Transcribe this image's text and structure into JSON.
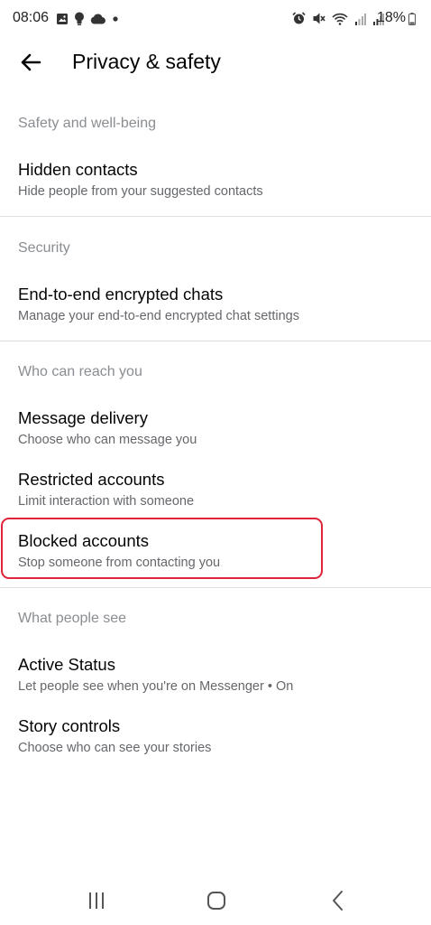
{
  "status_bar": {
    "time": "08:06",
    "battery": "18%"
  },
  "header": {
    "title": "Privacy & safety"
  },
  "sections": [
    {
      "header": "Safety and well-being",
      "items": [
        {
          "title": "Hidden contacts",
          "subtitle": "Hide people from your suggested contacts"
        }
      ]
    },
    {
      "header": "Security",
      "items": [
        {
          "title": "End-to-end encrypted chats",
          "subtitle": "Manage your end-to-end encrypted chat settings"
        }
      ]
    },
    {
      "header": "Who can reach you",
      "items": [
        {
          "title": "Message delivery",
          "subtitle": "Choose who can message you"
        },
        {
          "title": "Restricted accounts",
          "subtitle": "Limit interaction with someone"
        },
        {
          "title": "Blocked accounts",
          "subtitle": "Stop someone from contacting you"
        }
      ]
    },
    {
      "header": "What people see",
      "items": [
        {
          "title": "Active Status",
          "subtitle": "Let people see when you're on Messenger • On"
        },
        {
          "title": "Story controls",
          "subtitle": "Choose who can see your stories"
        }
      ]
    }
  ],
  "colors": {
    "highlight": "#e0243a",
    "section_header": "#8a8d91",
    "subtitle": "#65676b"
  }
}
